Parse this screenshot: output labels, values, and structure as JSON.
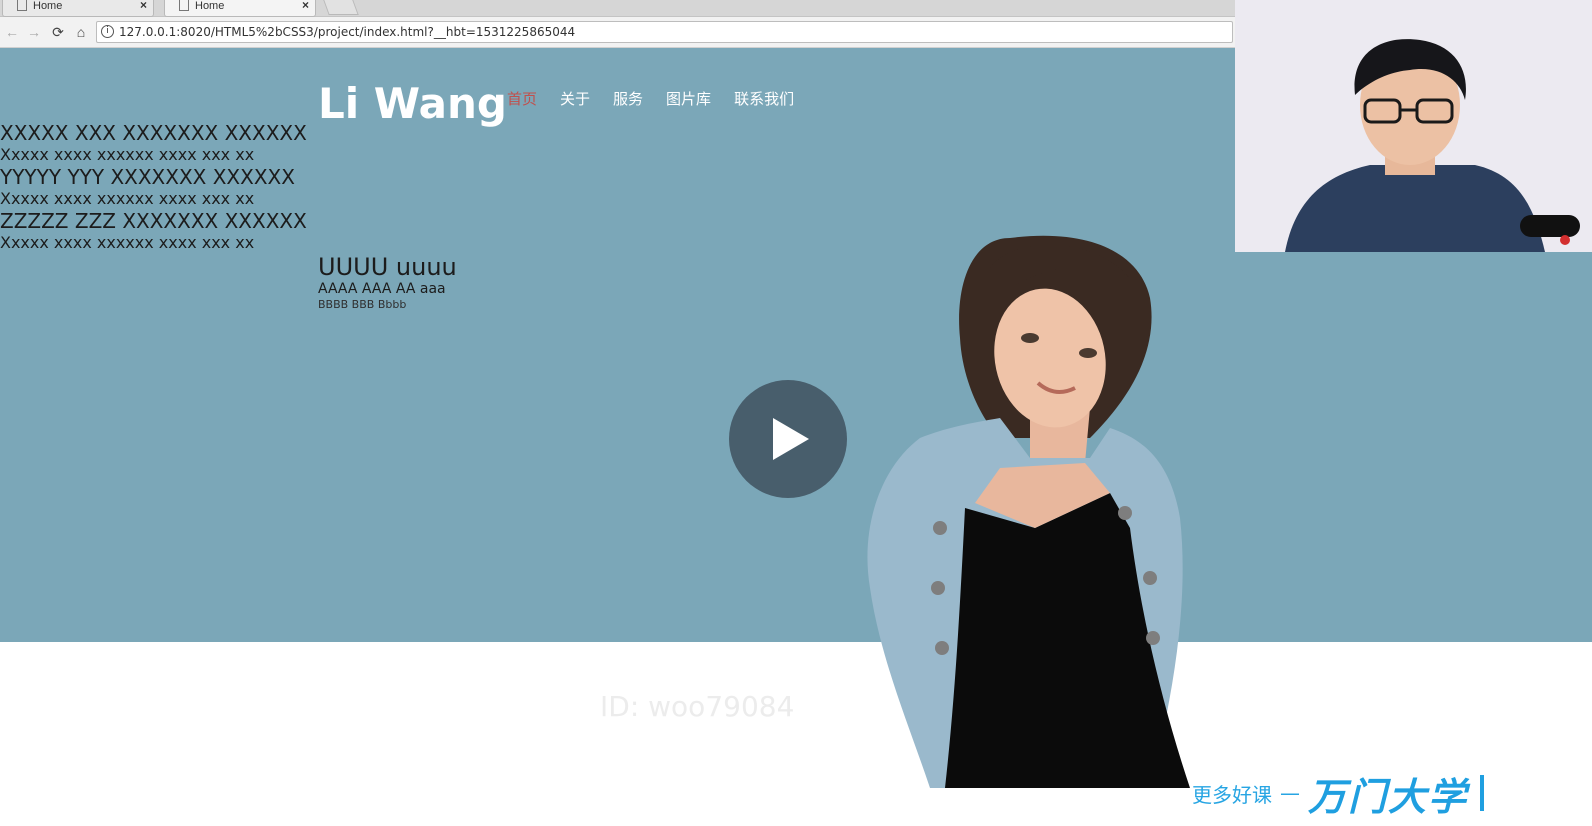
{
  "browser": {
    "tabs": [
      {
        "title": "Home"
      },
      {
        "title": "Home"
      }
    ],
    "url": "127.0.0.1:8020/HTML5%2bCSS3/project/index.html?__hbt=1531225865044",
    "icons": [
      "back-arrow-icon",
      "forward-arrow-icon",
      "reload-icon",
      "home-icon",
      "info-icon",
      "document-icon",
      "close-icon"
    ]
  },
  "page": {
    "brand": "Li Wang",
    "nav": [
      {
        "label": "首页",
        "active": true
      },
      {
        "label": "关于",
        "active": false
      },
      {
        "label": "服务",
        "active": false
      },
      {
        "label": "图片库",
        "active": false
      },
      {
        "label": "联系我们",
        "active": false
      }
    ],
    "lines": [
      "XXXXX XXX XXXXXXX XXXXXX",
      "Xxxxx xxxx xxxxxx xxxx xxx xx",
      "YYYYY YYY XXXXXXX XXXXXX",
      "Xxxxx xxxx xxxxxx xxxx xxx xx",
      "ZZZZZ ZZZ XXXXXXX XXXXXX",
      "Xxxxx xxxx xxxxxx xxxx xxx xx"
    ],
    "heading1": "UUUU uuuu",
    "heading2": "AAAA AAA AA aaa",
    "heading3": "BBBB BBB Bbbb",
    "watermark": "ID: woo79084",
    "colors": {
      "hero_bg": "#7ba7b8",
      "nav_active": "#c0504d",
      "play_button": "#485e6c",
      "promo": "#27a5e3"
    }
  },
  "promo": {
    "text": "更多好课",
    "dash": "—",
    "brand": "万门大学"
  }
}
